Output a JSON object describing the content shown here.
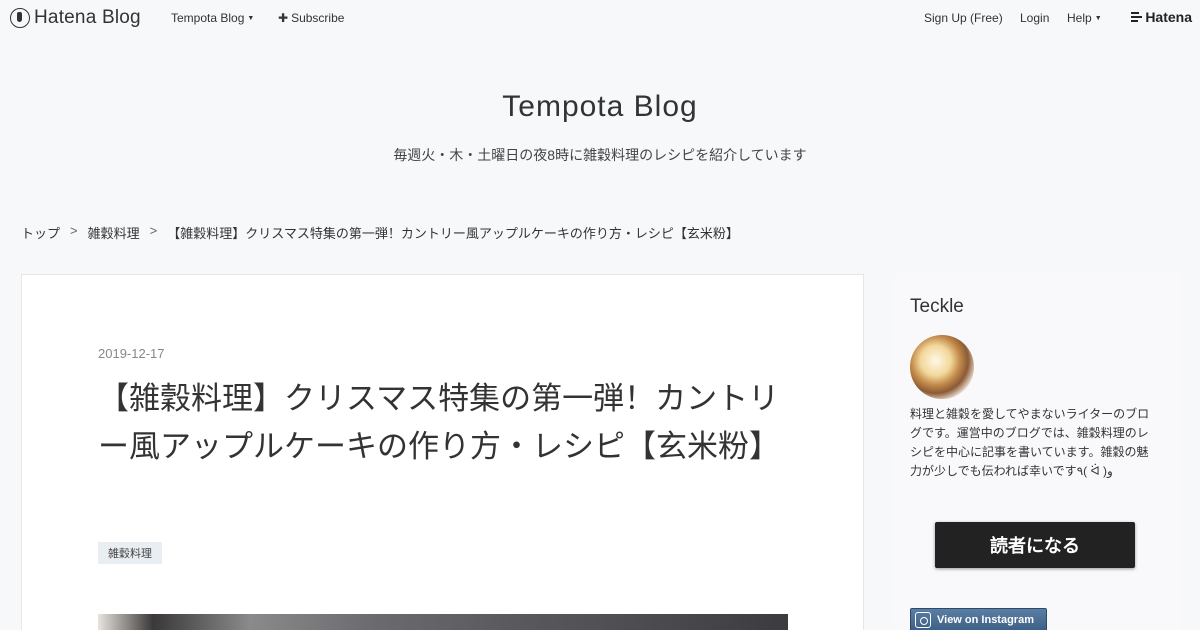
{
  "topbar": {
    "logo_text": "Hatena Blog",
    "blog_menu": "Tempota Blog",
    "subscribe": "Subscribe",
    "signup": "Sign Up (Free)",
    "login": "Login",
    "help": "Help",
    "hatena": "Hatena"
  },
  "header": {
    "title": "Tempota Blog",
    "description": "毎週火・木・土曜日の夜8時に雑穀料理のレシピを紹介しています"
  },
  "breadcrumb": {
    "items": [
      "トップ",
      "雑穀料理",
      "【雑穀料理】クリスマス特集の第一弾！カントリー風アップルケーキの作り方・レシピ【玄米粉】"
    ],
    "separator": ">"
  },
  "post": {
    "date": "2019-12-17",
    "title": "【雑穀料理】クリスマス特集の第一弾！カントリー風アップルケーキの作り方・レシピ【玄米粉】",
    "category": "雑穀料理"
  },
  "sidebar": {
    "author": "Teckle",
    "bio": "料理と雑穀を愛してやまないライターのブログです。運営中のブログでは、雑穀料理のレシピを中心に記事を書いています。雑穀の魅力が少しでも伝われば幸いです٩( ᐛ )و",
    "follow_label": "読者になる",
    "instagram_label": "View on Instagram"
  }
}
